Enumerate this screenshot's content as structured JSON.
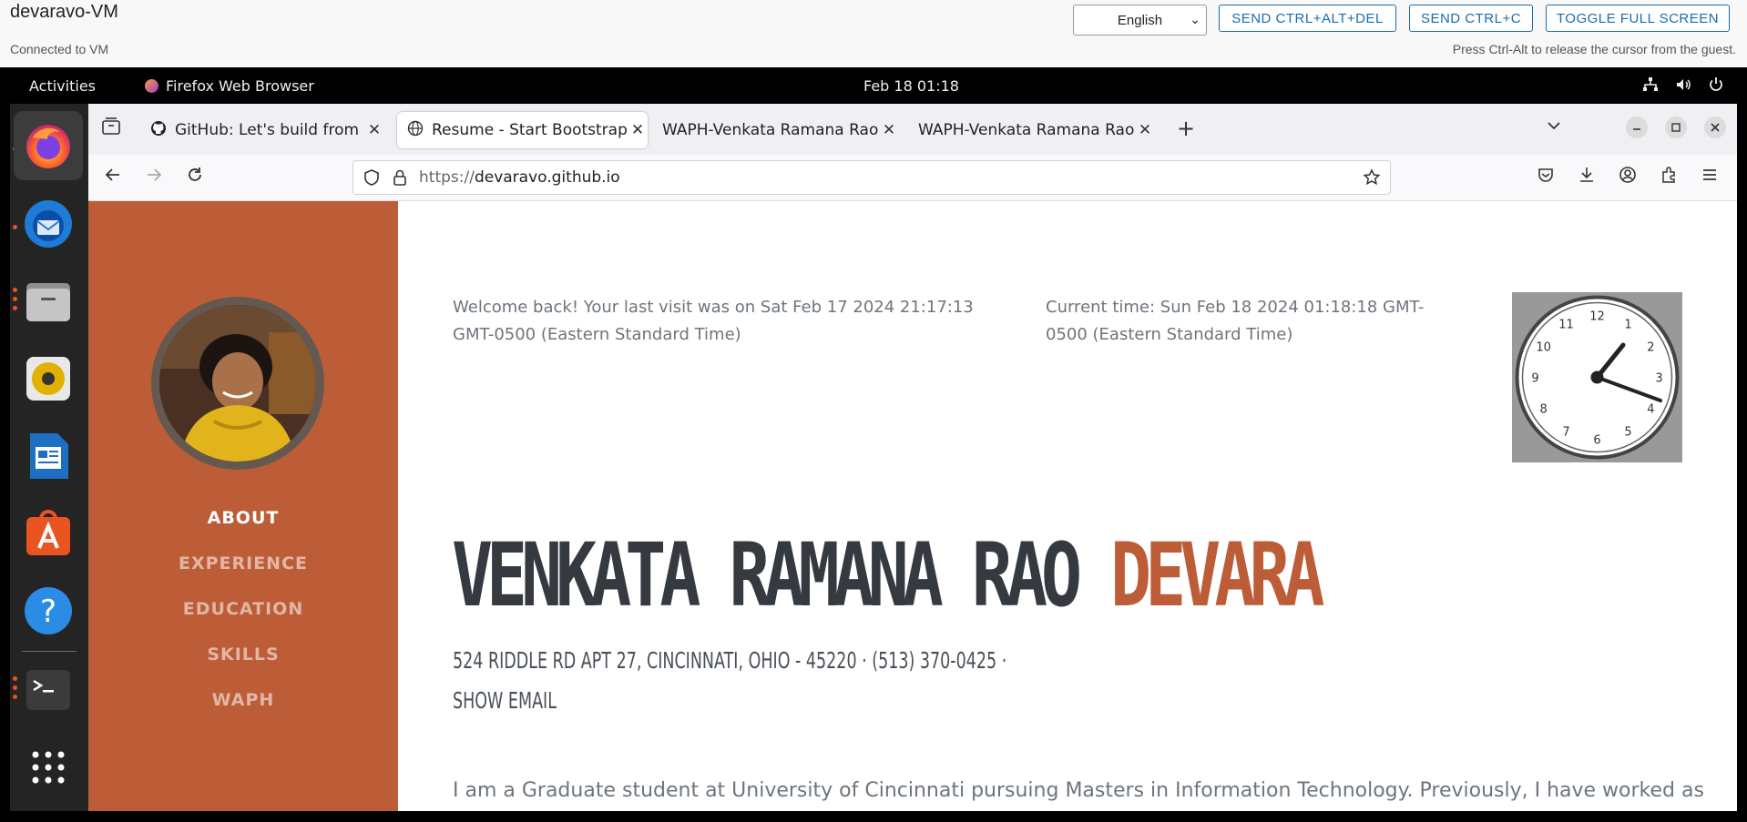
{
  "vm": {
    "title": "devaravo-VM",
    "status": "Connected to VM",
    "language": "English",
    "buttons": [
      "SEND CTRL+ALT+DEL",
      "SEND CTRL+C",
      "TOGGLE FULL SCREEN"
    ],
    "hint": "Press Ctrl-Alt to release the cursor from the guest."
  },
  "topbar": {
    "activities": "Activities",
    "app_name": "Firefox Web Browser",
    "clock": "Feb 18  01:18",
    "tray_icons": [
      "network-icon",
      "volume-icon",
      "power-icon"
    ]
  },
  "dock": {
    "apps": [
      "firefox-icon",
      "thunderbird-icon",
      "files-icon",
      "rhythmbox-icon",
      "writer-icon",
      "app-center-icon",
      "help-icon",
      "terminal-icon",
      "show-apps-icon"
    ]
  },
  "browser": {
    "tabs": [
      {
        "label": "GitHub: Let's build from here",
        "icon": "github-icon",
        "selected": false
      },
      {
        "label": "Resume - Start Bootstrap",
        "icon": "globe-icon",
        "selected": true
      },
      {
        "label": "WAPH-Venkata Ramana Rao",
        "icon": "",
        "selected": false
      },
      {
        "label": "WAPH-Venkata Ramana Rao",
        "icon": "",
        "selected": false
      }
    ],
    "url_scheme": "https://",
    "url_host": "devaravo.github.io"
  },
  "page": {
    "nav": [
      {
        "label": "ABOUT",
        "active": true
      },
      {
        "label": "EXPERIENCE",
        "active": false
      },
      {
        "label": "EDUCATION",
        "active": false
      },
      {
        "label": "SKILLS",
        "active": false
      },
      {
        "label": "WAPH",
        "active": false
      }
    ],
    "welcome": "Welcome back! Your last visit was on Sat Feb 17 2024 21:17:13 GMT-0500 (Eastern Standard Time)",
    "current_time": "Current time: Sun Feb 18 2024 01:18:18 GMT-0500 (Eastern Standard Time)",
    "clock_numbers": [
      "12",
      "1",
      "2",
      "3",
      "4",
      "5",
      "6",
      "7",
      "8",
      "9",
      "10",
      "11"
    ],
    "first_name": "VENKATA RAMANA RAO",
    "last_name": "DEVARA",
    "address": "524 RIDDLE RD APT 27, CINCINNATI, OHIO - 45220 · (513) 370-0425 ·",
    "show_email": "SHOW EMAIL",
    "bio": "I am a Graduate student at University of Cincinnati pursuing Masters in Information Technology. Previously, I have worked as"
  },
  "colors": {
    "sidebar": "#bd5d38",
    "accent": "#bd5d38",
    "heading": "#343a40",
    "vm_button": "#1a6cae"
  }
}
